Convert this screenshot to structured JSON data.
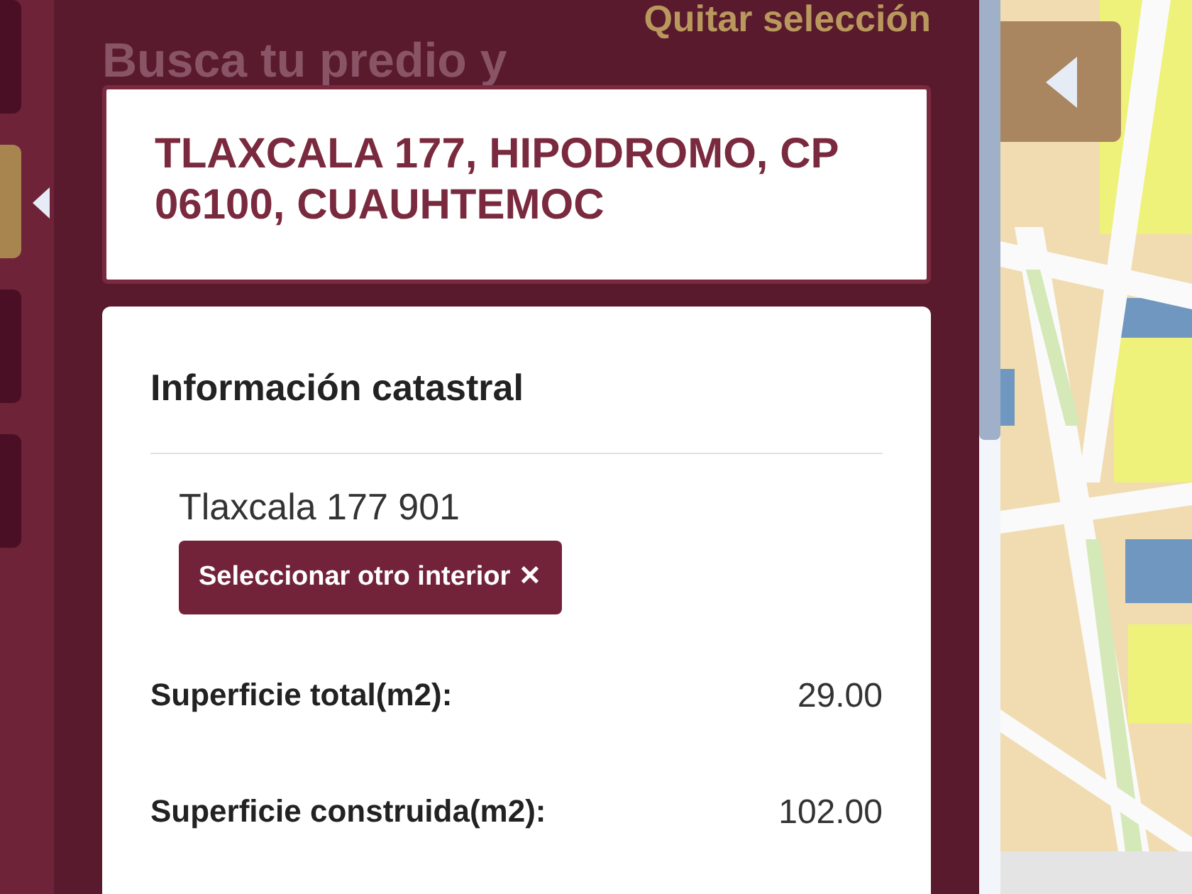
{
  "rail_tabs": [
    {
      "selected": false
    },
    {
      "selected": true
    },
    {
      "selected": false
    },
    {
      "selected": false
    }
  ],
  "panel": {
    "clear_selection": "Quitar selección",
    "heading": "Busca tu predio y",
    "address": "TLAXCALA 177, HIPODROMO, CP 06100, CUAUHTEMOC"
  },
  "info": {
    "title": "Información catastral",
    "unit": "Tlaxcala 177 901",
    "change_button": "Seleccionar otro interior",
    "change_button_icon": "✕",
    "fields": [
      {
        "label": "Superficie total(m2):",
        "value": "29.00"
      },
      {
        "label": "Superficie construida(m2):",
        "value": "102.00"
      }
    ]
  }
}
